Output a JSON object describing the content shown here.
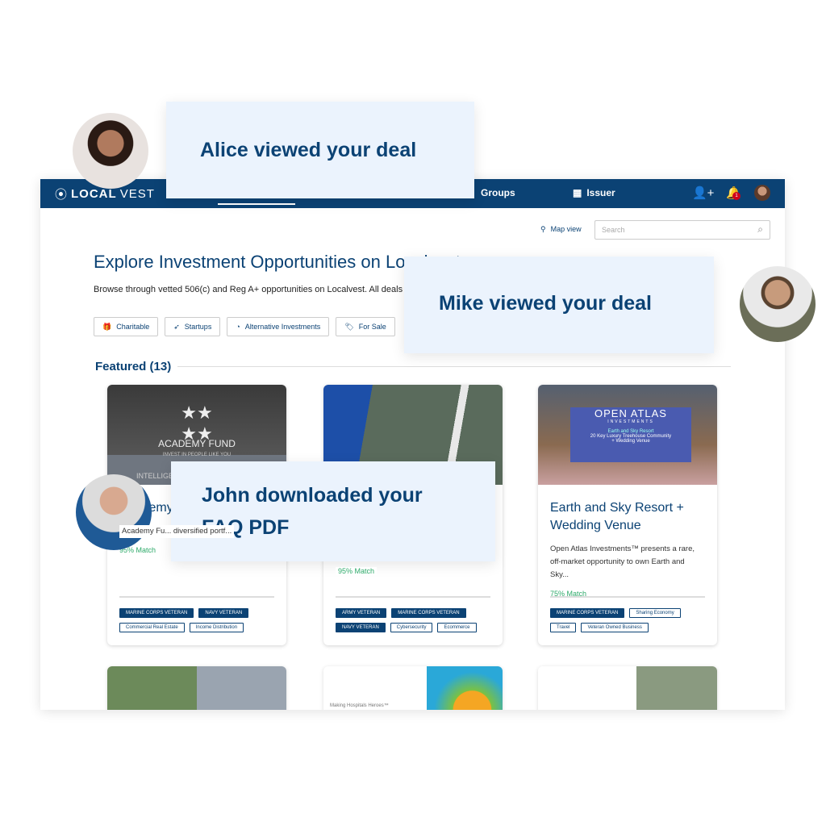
{
  "nav": {
    "logo_a": "LOCAL",
    "logo_b": "VEST",
    "groups": "Groups",
    "issuer": "Issuer",
    "notification_count": "1",
    "brand_color": "#0b4274"
  },
  "toolbar": {
    "map_view": "Map view",
    "search_placeholder": "Search"
  },
  "page": {
    "title": "Explore Investment Opportunities on Localvest",
    "subtitle": "Browse through vetted 506(c) and Reg A+ opportunities on Localvest. All deals"
  },
  "categories": [
    "Charitable",
    "Startups",
    "Alternative Investments",
    "For Sale"
  ],
  "featured": "Featured (13)",
  "cards": [
    {
      "img_title": "ACADEMY FUND",
      "img_sub": "INVEST IN PEOPLE LIKE YOU",
      "img_band": "INTELLIGENT",
      "title": "Academy Fund",
      "desc": "Academy Fu... diversified portf...",
      "match": "95% Match",
      "tags": [
        "MARINE CORPS VETERAN",
        "NAVY VETERAN"
      ],
      "tags2": [
        "Commercial Real Estate",
        "Income Distribution"
      ]
    },
    {
      "title": "",
      "desc": "",
      "match": "95% Match",
      "tags": [
        "ARMY VETERAN",
        "MARINE CORPS VETERAN",
        "NAVY VETERAN"
      ],
      "tags2": [
        "Cybersecurity",
        "Ecommerce"
      ]
    },
    {
      "img_title": "OPEN ATLAS",
      "img_sub": "INVESTMENTS",
      "img_l1": "Earth and Sky Resort",
      "img_l2": "20 Key Luxury Treehouse Community",
      "img_l3": "+ Wedding Venue",
      "title": "Earth and Sky Resort + Wedding Venue",
      "desc": "Open Atlas Investments™ presents a rare, off-market opportunity to own Earth and Sky...",
      "match": "75% Match",
      "tags": [
        "MARINE CORPS VETERAN"
      ],
      "tags2": [
        "Sharing Economy",
        "Travel",
        "Veteran Owned Business"
      ]
    }
  ],
  "row2": {
    "hospital_text": "Making Hospitals Heroes™"
  },
  "notifications": {
    "alice": "Alice viewed your deal",
    "mike": "Mike viewed your deal",
    "john": "John downloaded your FAQ PDF"
  }
}
